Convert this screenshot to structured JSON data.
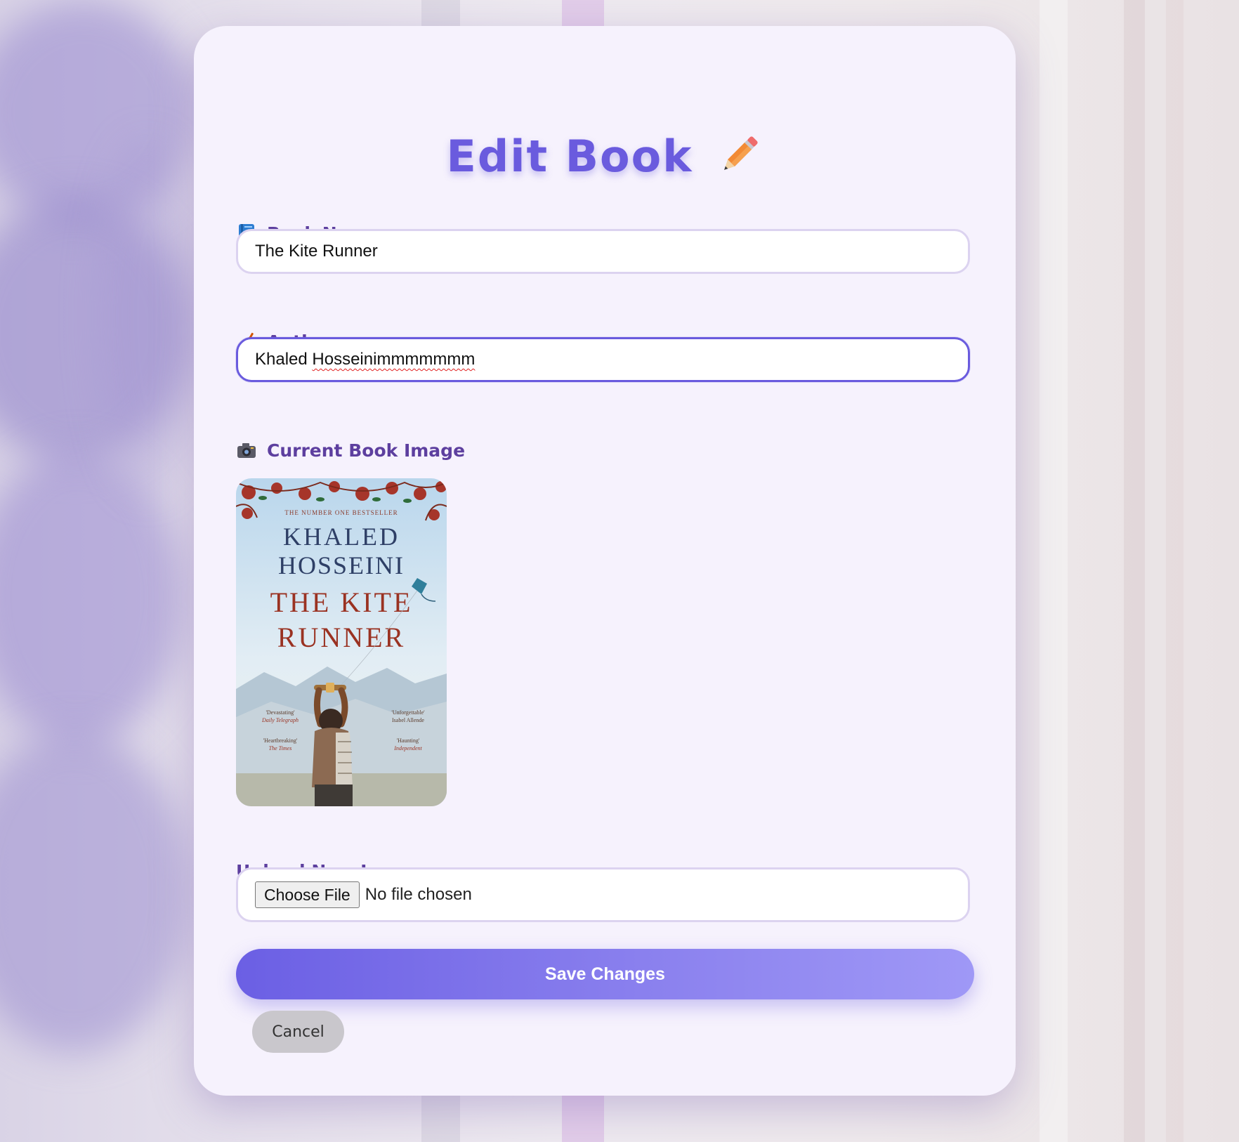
{
  "title": {
    "text": "Edit Book",
    "icon": "pencil-icon"
  },
  "fields": {
    "book_name": {
      "label": "Book Name",
      "icon": "blue-book-icon",
      "value": "The Kite Runner"
    },
    "author": {
      "label": "Author",
      "icon": "writing-hand-icon",
      "value_first": "Khaled ",
      "value_misspelled": "Hosseinimmmmmmm"
    },
    "current_image": {
      "label": "Current Book Image",
      "icon": "camera-icon"
    },
    "upload": {
      "label": "Upload New Image",
      "button": "Choose File",
      "status": "No file chosen"
    }
  },
  "cover": {
    "tagline": "THE NUMBER ONE BESTSELLER",
    "author_line1": "KHALED",
    "author_line2": "HOSSEINI",
    "title_line1": "THE KITE",
    "title_line2": "RUNNER",
    "quotes": [
      {
        "quote": "'Devastating'",
        "source": "Daily Telegraph"
      },
      {
        "quote": "'Unforgettable'",
        "source": "Isabel Allende"
      },
      {
        "quote": "'Heartbreaking'",
        "source": "The Times"
      },
      {
        "quote": "'Haunting'",
        "source": "Independent"
      }
    ]
  },
  "actions": {
    "save": "Save Changes",
    "cancel": "Cancel"
  },
  "colors": {
    "accent": "#6a5bde",
    "label": "#5d3f9f",
    "card": "#f6f2fd"
  }
}
